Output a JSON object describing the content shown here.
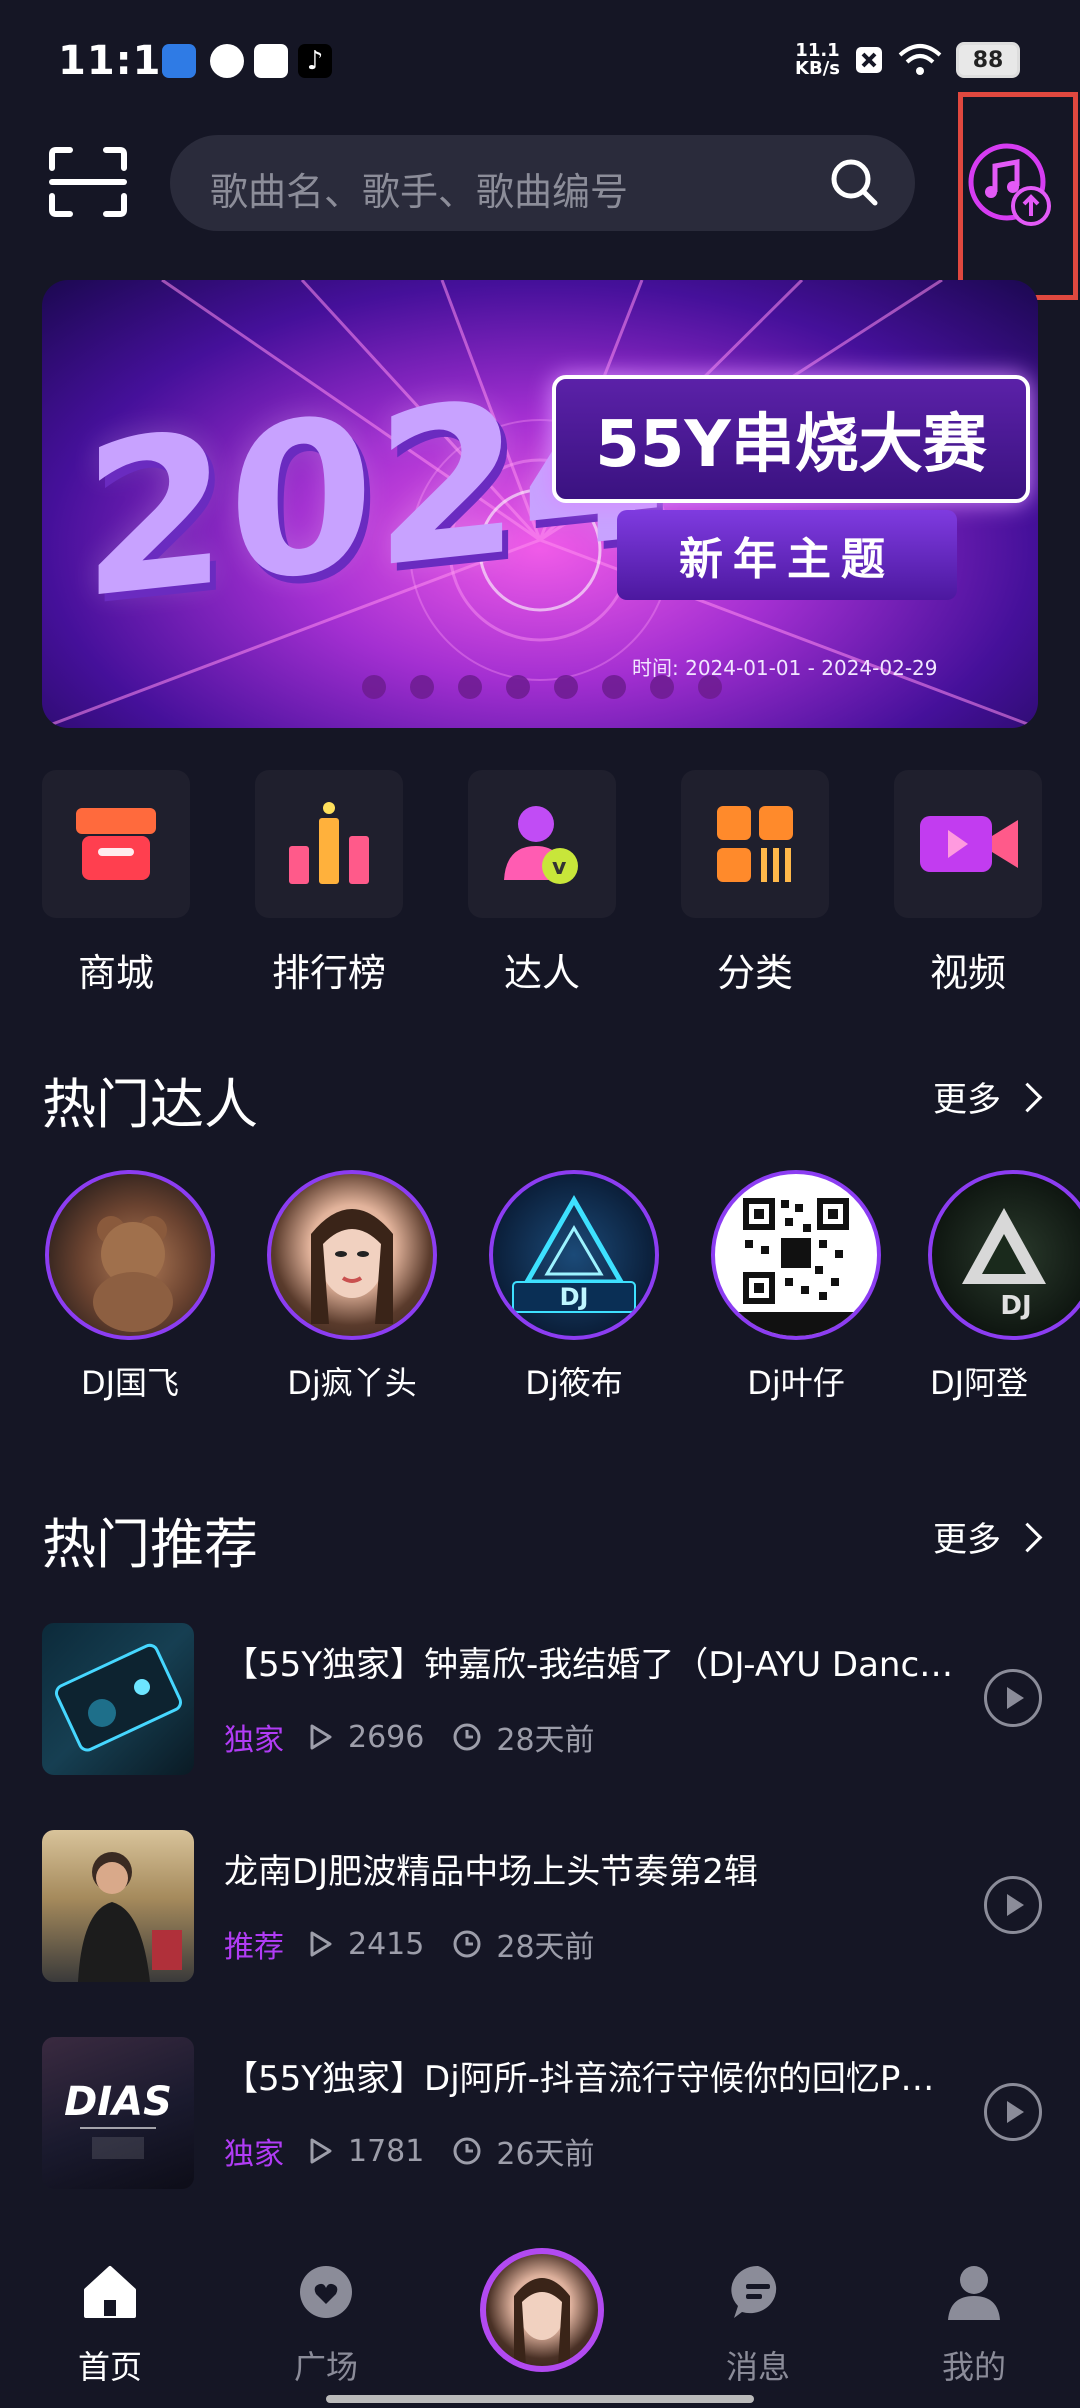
{
  "status": {
    "time": "11:10",
    "speed_value": "11.1",
    "speed_unit": "KB/s",
    "battery": "88"
  },
  "search": {
    "placeholder": "歌曲名、歌手、歌曲编号"
  },
  "banner": {
    "year": "2024",
    "title": "55Y串烧大赛",
    "subtitle": "新年主题",
    "time_label": "时间: 2024-01-01 - 2024-02-29",
    "page_count": 8,
    "active_page": 0
  },
  "quick_menu": [
    {
      "label": "商城",
      "icon": "store-icon"
    },
    {
      "label": "排行榜",
      "icon": "ranking-icon"
    },
    {
      "label": "达人",
      "icon": "talent-icon"
    },
    {
      "label": "分类",
      "icon": "category-icon"
    },
    {
      "label": "视频",
      "icon": "video-icon"
    }
  ],
  "hot_talents": {
    "title": "热门达人",
    "more": "更多",
    "items": [
      {
        "name": "DJ国飞"
      },
      {
        "name": "Dj疯丫头"
      },
      {
        "name": "Dj筱布"
      },
      {
        "name": "Dj叶仔"
      },
      {
        "name": "DJ阿登"
      }
    ]
  },
  "hot_recommend": {
    "title": "热门推荐",
    "more": "更多",
    "items": [
      {
        "title": "【55Y独家】钟嘉欣-我结婚了（DJ-AYU Dance…",
        "tag": "独家",
        "plays": "2696",
        "time": "28天前"
      },
      {
        "title": "龙南DJ肥波精品中场上头节奏第2辑",
        "tag": "推荐",
        "plays": "2415",
        "time": "28天前"
      },
      {
        "title": "【55Y独家】Dj阿所-抖音流行守候你的回忆P…",
        "tag": "独家",
        "plays": "1781",
        "time": "26天前"
      }
    ]
  },
  "tabs": {
    "home": "首页",
    "plaza": "广场",
    "messages": "消息",
    "mine": "我的"
  },
  "colors": {
    "background": "#151625",
    "accent": "#b13cf5",
    "highlight_box": "#e0483f"
  }
}
